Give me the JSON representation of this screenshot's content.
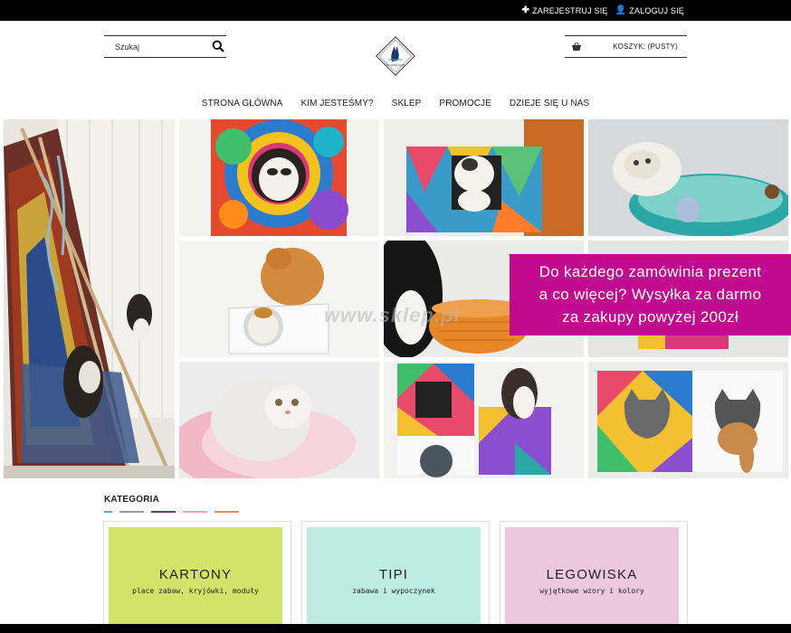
{
  "topbar": {
    "register_label": "ZAREJESTRUJ SIĘ",
    "login_label": "ZALOGUJ SIĘ"
  },
  "header": {
    "search_placeholder": "Szukaj",
    "logo_text": "NA SWOIJ ŁAPIE",
    "cart_label": "KOSZYK: (PUSTY)"
  },
  "nav": {
    "items": [
      "STRONA GŁÓWNA",
      "KIM JESTEŚMY?",
      "SKLEP",
      "PROMOCJE",
      "DZIEJE SIĘ U NAS"
    ]
  },
  "banner": {
    "line1": "Do każdego zamówinia prezent",
    "line2": "a co więcej? Wysyłka za darmo",
    "line3": "za zakupy powyżej 200zł",
    "watermark": "www.sklep.pl"
  },
  "category": {
    "heading": "KATEGORIA",
    "bar_colors": [
      "#5bb5a2",
      "#8aa0a8",
      "#6b3b6b",
      "#e7a7b4",
      "#f08a60"
    ],
    "cards": [
      {
        "title": "KARTONY",
        "subtitle": "place zabaw, kryjówki, moduły",
        "color": "#d2e36a"
      },
      {
        "title": "TIPI",
        "subtitle": "zabawa i wypoczynek",
        "color": "#bfece2"
      },
      {
        "title": "LEGOWISKA",
        "subtitle": "wyjątkowe wzory i kolory",
        "color": "#ebc8de"
      }
    ]
  }
}
